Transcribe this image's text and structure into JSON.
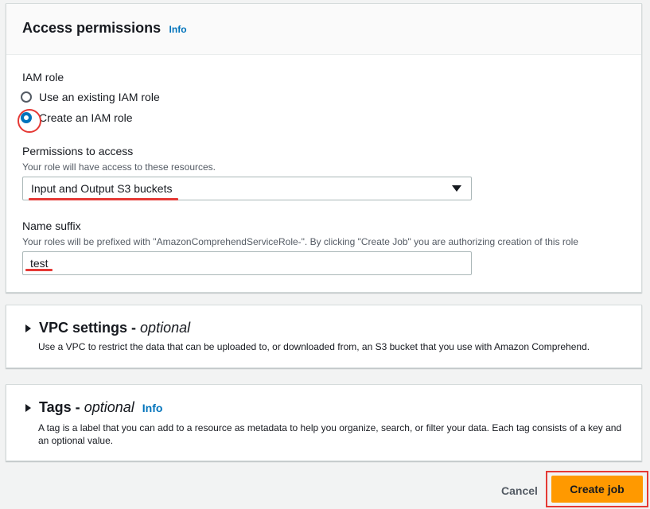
{
  "access": {
    "title": "Access permissions",
    "info": "Info",
    "iam_role_label": "IAM role",
    "radio_existing": "Use an existing IAM role",
    "radio_create": "Create an IAM role",
    "selected": "Create an IAM role",
    "permissions_label": "Permissions to access",
    "permissions_desc": "Your role will have access to these resources.",
    "permissions_value": "Input and Output S3 buckets",
    "name_suffix_label": "Name suffix",
    "name_suffix_desc": "Your roles will be prefixed with \"AmazonComprehendServiceRole-\". By clicking \"Create Job\" you are authorizing creation of this role",
    "name_suffix_value": "test"
  },
  "vpc": {
    "title": "VPC settings - ",
    "optional": "optional",
    "desc": "Use a VPC to restrict the data that can be uploaded to, or downloaded from, an S3 bucket that you use with Amazon Comprehend."
  },
  "tags": {
    "title": "Tags - ",
    "optional": "optional",
    "info": "Info",
    "desc": "A tag is a label that you can add to a resource as metadata to help you organize, search, or filter your data. Each tag consists of a key and an optional value."
  },
  "footer": {
    "cancel": "Cancel",
    "create": "Create job"
  },
  "colors": {
    "accent": "#0073bb",
    "primary_button": "#ff9900",
    "annotation": "#e53935"
  }
}
